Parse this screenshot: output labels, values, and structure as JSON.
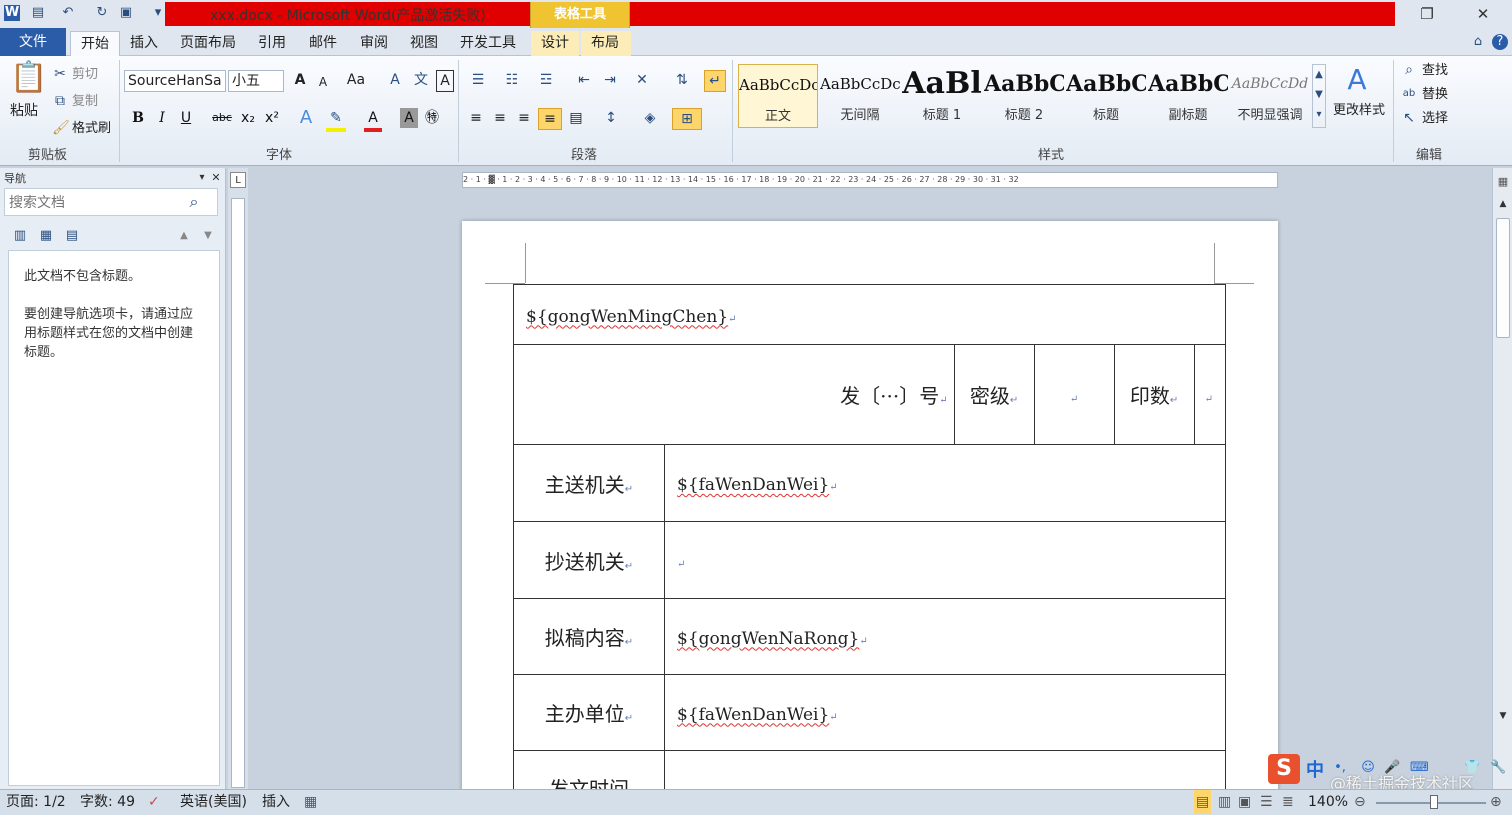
{
  "window": {
    "title": "xxx.docx - Microsoft Word(产品激活失败)",
    "context_tab_group": "表格工具",
    "brand_color": "#2a5ca8"
  },
  "tabs": [
    "文件",
    "开始",
    "插入",
    "页面布局",
    "引用",
    "邮件",
    "审阅",
    "视图",
    "开发工具",
    "设计",
    "布局"
  ],
  "ribbon": {
    "clipboard": {
      "paste": "粘贴",
      "cut": "剪切",
      "copy": "复制",
      "format_painter": "格式刷",
      "label": "剪贴板"
    },
    "font": {
      "font_name": "SourceHanSa",
      "font_size": "小五",
      "label": "字体",
      "bold": "B",
      "italic": "I",
      "underline": "U",
      "strike": "abc",
      "sub": "x₂",
      "sup": "x²"
    },
    "paragraph": {
      "label": "段落"
    },
    "styles": {
      "label": "样式",
      "items": [
        {
          "sample": "AaBbCcDc",
          "name": "正文"
        },
        {
          "sample": "AaBbCcDc",
          "name": "无间隔"
        },
        {
          "sample": "AaBl",
          "name": "标题 1"
        },
        {
          "sample": "AaBbC",
          "name": "标题 2"
        },
        {
          "sample": "AaBbC",
          "name": "标题"
        },
        {
          "sample": "AaBbC",
          "name": "副标题"
        },
        {
          "sample": "AaBbCcDd",
          "name": "不明显强调"
        }
      ],
      "change_styles": "更改样式"
    },
    "editing": {
      "label": "编辑",
      "find": "查找",
      "replace": "替换",
      "select": "选择"
    }
  },
  "nav": {
    "header": "导航",
    "search_placeholder": "搜索文档",
    "msg1": "此文档不包含标题。",
    "msg2": "要创建导航选项卡，请通过应用标题样式在您的文档中创建标题。"
  },
  "ruler_ticks": "2 · 1 · ▓ · 1 · 2 · 3 · 4 · 5 · 6 · 7 · 8 · 9 · 10 · 11 · 12 · 13 · 14 · 15 · 16 · 17 · 18 · 19 · 20 · 21 · 22 · 23 · 24 · 25 · 26 · 27 · 28 · 29 · 30 · 31 · 32",
  "document": {
    "row1": "${gongWenMingChen}",
    "fa_hao": "发〔···〕号",
    "miji": "密级",
    "yinshu": "印数",
    "zhusong_label": "主送机关",
    "zhusong_value": "${faWenDanWei}",
    "chaosong_label": "抄送机关",
    "nigao_label": "拟稿内容",
    "nigao_value": "${gongWenNaRong}",
    "zhuban_label": "主办单位",
    "zhuban_value": "${faWenDanWei}",
    "fawen_label": "发文时间"
  },
  "status": {
    "page": "页面: 1/2",
    "words": "字数: 49",
    "lang": "英语(美国)",
    "mode": "插入",
    "zoom": "140%"
  },
  "ime": {
    "zh": "中"
  },
  "watermark": "@稀土掘金技术社区"
}
